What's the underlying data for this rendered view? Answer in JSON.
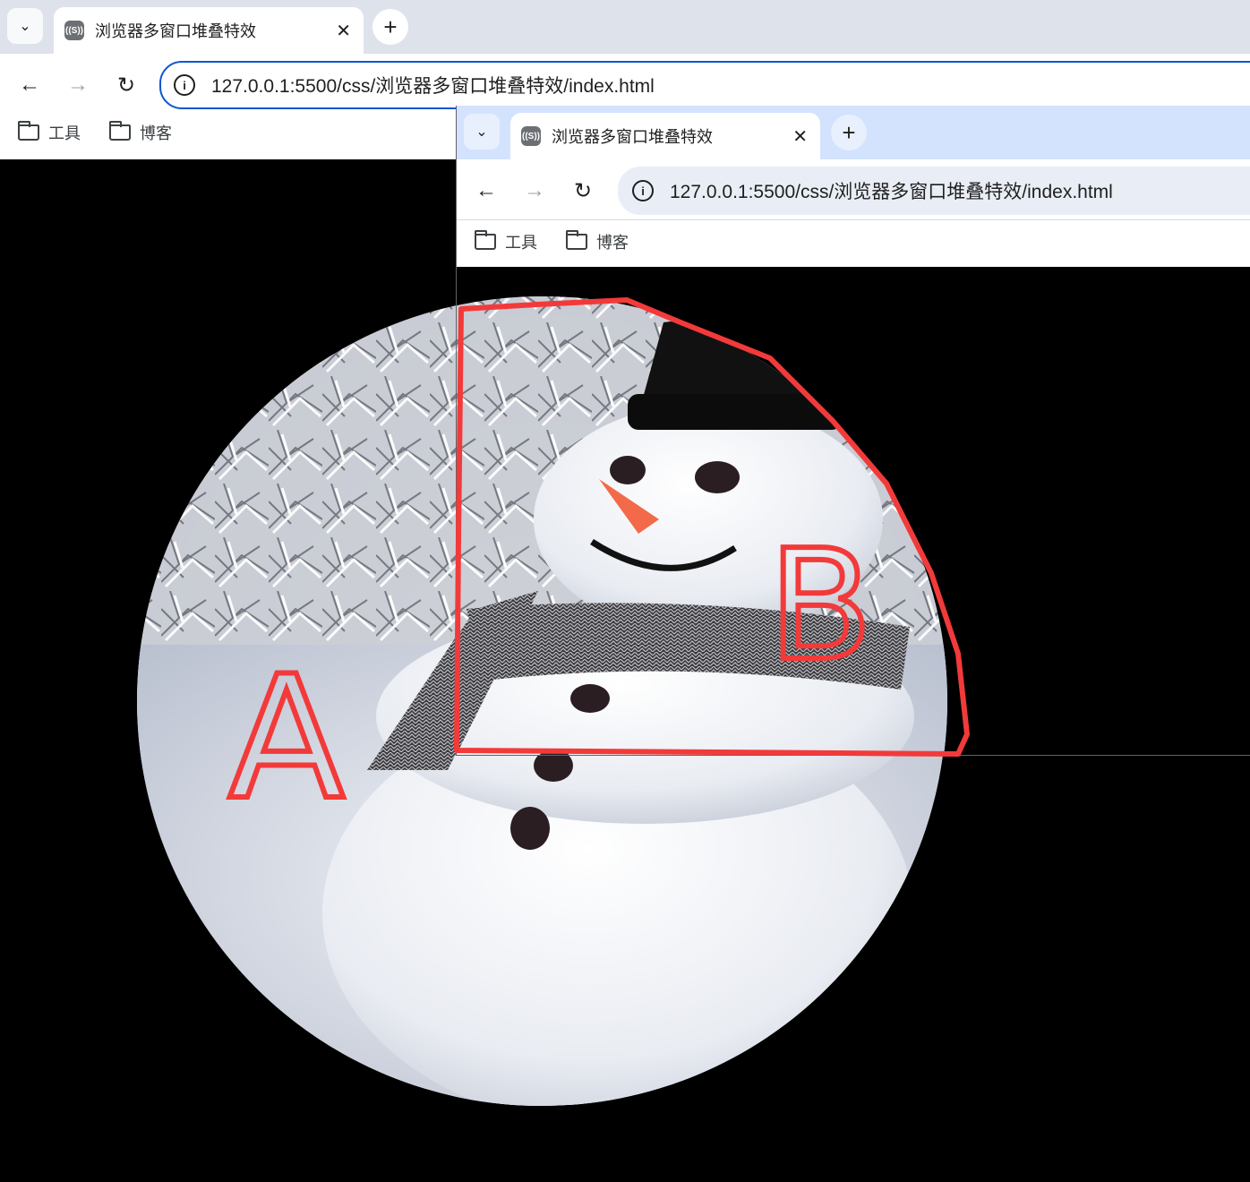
{
  "window_a": {
    "tab": {
      "title": "浏览器多窗口堆叠特效",
      "favicon": "((S))"
    },
    "url": "127.0.0.1:5500/css/浏览器多窗口堆叠特效/index.html",
    "bookmarks": [
      {
        "label": "工具"
      },
      {
        "label": "博客"
      }
    ]
  },
  "window_b": {
    "tab": {
      "title": "浏览器多窗口堆叠特效",
      "favicon": "((S))"
    },
    "url": "127.0.0.1:5500/css/浏览器多窗口堆叠特效/index.html",
    "bookmarks": [
      {
        "label": "工具"
      },
      {
        "label": "博客"
      }
    ]
  },
  "annotations": {
    "label_a": "A",
    "label_b": "B",
    "color": "#f23a3a"
  },
  "icons": {
    "tab_list": "chevron-down-icon",
    "close": "close-icon",
    "new_tab": "plus-icon",
    "back": "back-arrow-icon",
    "forward": "forward-arrow-icon",
    "reload": "reload-icon",
    "site_info": "info-icon",
    "bookmark_folder": "folder-icon"
  }
}
